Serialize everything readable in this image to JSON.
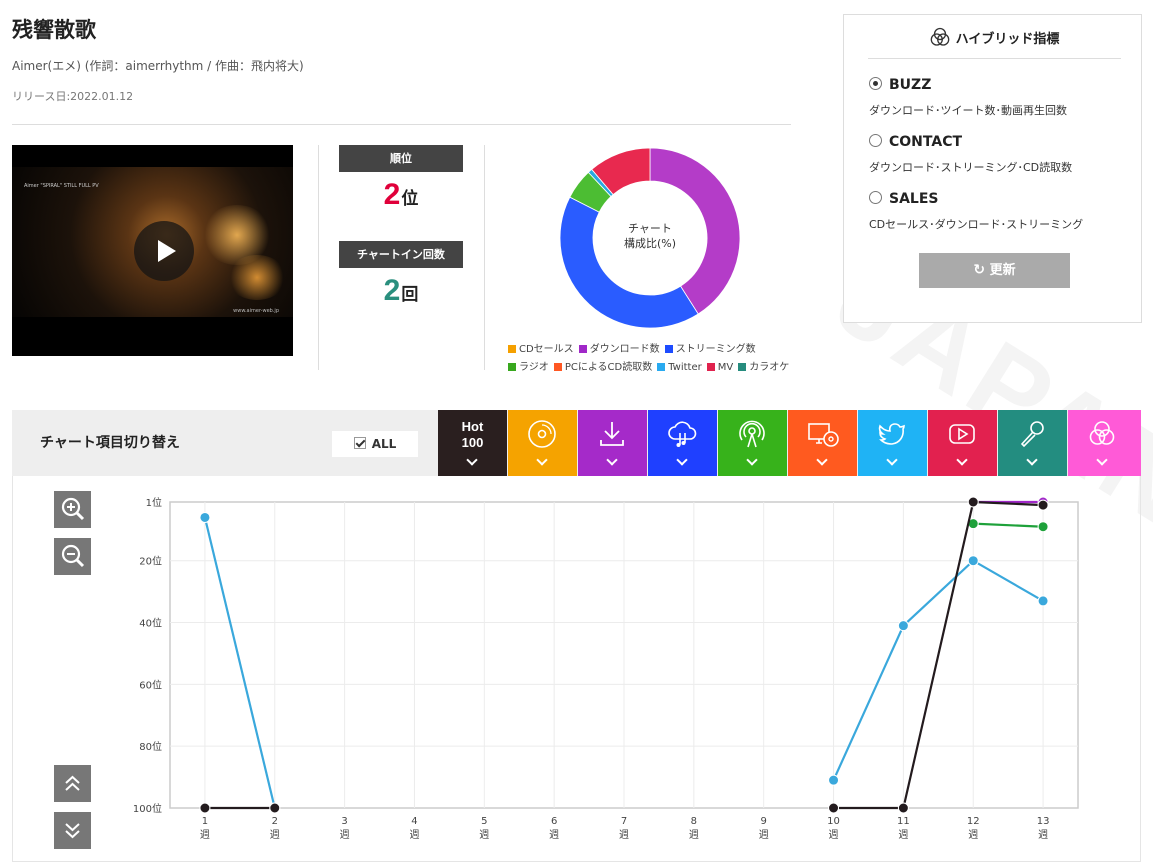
{
  "watermark": "JAPAN",
  "song": {
    "title": "残響散歌",
    "meta": "Aimer(エメ) (作詞：aimerrhythm / 作曲：飛内将大)",
    "release": "リリース日:2022.01.12"
  },
  "video": {
    "caption_top": "Aimer \"SPIRAL\" STILL FULL PV",
    "caption_bottom": "www.aimer-web.jp"
  },
  "stats": {
    "rank_label": "順位",
    "rank_value": "2",
    "rank_unit": "位",
    "rank_color": "#e0003a",
    "chartin_label": "チャートイン回数",
    "chartin_value": "2",
    "chartin_unit": "回",
    "chartin_color": "#2a8f7e"
  },
  "donut": {
    "center_line1": "チャート",
    "center_line2": "構成比(%)",
    "segments": [
      {
        "name": "ダウンロード数",
        "percent": 41,
        "color": "#b43cc8"
      },
      {
        "name": "ストリーミング数",
        "percent": 41.5,
        "color": "#2a5cff"
      },
      {
        "name": "ラジオ",
        "percent": 5.5,
        "color": "#4cbd33"
      },
      {
        "name": "Twitter",
        "percent": 0.8,
        "color": "#2aa8e0"
      },
      {
        "name": "MV",
        "percent": 11.2,
        "color": "#e8294f"
      }
    ],
    "legend_row1": [
      {
        "label": "CDセールス",
        "color": "#f5a000"
      },
      {
        "label": "ダウンロード数",
        "color": "#a028c8"
      },
      {
        "label": "ストリーミング数",
        "color": "#1d4cff"
      }
    ],
    "legend_row2": [
      {
        "label": "ラジオ",
        "color": "#38a81e"
      },
      {
        "label": "PCによるCD読取数",
        "color": "#ff5722"
      },
      {
        "label": "Twitter",
        "color": "#29aaf0"
      },
      {
        "label": "MV",
        "color": "#e0224e"
      },
      {
        "label": "カラオケ",
        "color": "#268c7e"
      }
    ]
  },
  "hybrid": {
    "title": "ハイブリッド指標",
    "options": [
      {
        "label": "BUZZ",
        "desc": "ダウンロード･ツイート数･動画再生回数",
        "selected": true
      },
      {
        "label": "CONTACT",
        "desc": "ダウンロード･ストリーミング･CD読取数",
        "selected": false
      },
      {
        "label": "SALES",
        "desc": "CDセールス･ダウンロード･ストリーミング",
        "selected": false
      }
    ],
    "update_label": "更新"
  },
  "switcher": {
    "label": "チャート項目切り替え",
    "all_label": "ALL",
    "hot_line1": "Hot",
    "hot_line2": "100",
    "categories": [
      {
        "icon": "hot100-icon",
        "color": "#2a1f1f"
      },
      {
        "icon": "cd-icon",
        "color": "#f5a300"
      },
      {
        "icon": "download-icon",
        "color": "#a52ac9"
      },
      {
        "icon": "streaming-icon",
        "color": "#1f40ff"
      },
      {
        "icon": "radio-icon",
        "color": "#37b21b"
      },
      {
        "icon": "pc-cd-icon",
        "color": "#ff5a1f"
      },
      {
        "icon": "twitter-icon",
        "color": "#1fb3f5"
      },
      {
        "icon": "youtube-icon",
        "color": "#e2214f"
      },
      {
        "icon": "karaoke-icon",
        "color": "#238d80"
      },
      {
        "icon": "hybrid-icon",
        "color": "#ff5ad7"
      }
    ]
  },
  "chart_data": {
    "type": "line",
    "x_unit": "週",
    "x": [
      1,
      2,
      3,
      4,
      5,
      6,
      7,
      8,
      9,
      10,
      11,
      12,
      13
    ],
    "y_tick_labels": [
      "1位",
      "20位",
      "40位",
      "60位",
      "80位",
      "100位"
    ],
    "y_ticks": [
      1,
      20,
      40,
      60,
      80,
      100
    ],
    "ylim": [
      1,
      100
    ],
    "y_inverted": true,
    "grid": true,
    "series": [
      {
        "color": "#a028c8",
        "values": [
          null,
          null,
          null,
          null,
          null,
          null,
          null,
          null,
          null,
          null,
          null,
          1,
          1
        ]
      },
      {
        "color": "#1ea13a",
        "values": [
          null,
          null,
          null,
          null,
          null,
          null,
          null,
          null,
          null,
          null,
          null,
          8,
          9
        ]
      },
      {
        "color": "#3aa8dc",
        "values": [
          6,
          100,
          null,
          null,
          null,
          null,
          null,
          null,
          null,
          91,
          41,
          20,
          33
        ]
      },
      {
        "color": "#231b1e",
        "values": [
          100,
          100,
          null,
          null,
          null,
          null,
          null,
          null,
          null,
          100,
          100,
          1,
          2
        ]
      }
    ]
  }
}
